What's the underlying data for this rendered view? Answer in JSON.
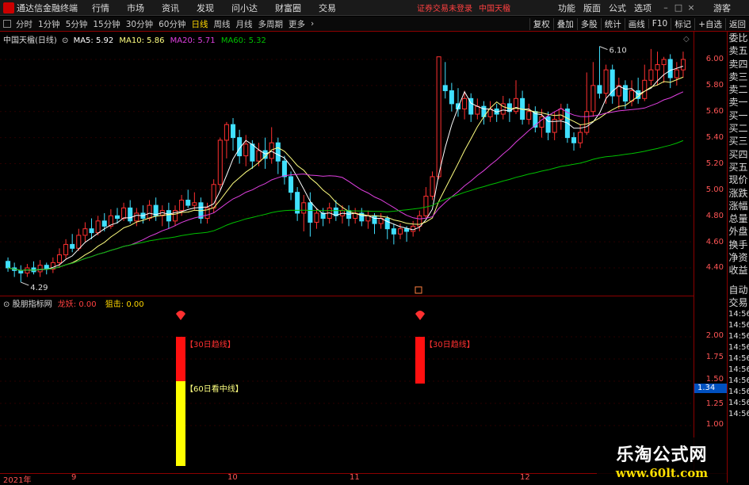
{
  "menubar": {
    "app_title": "通达信金融终端",
    "items": [
      "行情",
      "市场",
      "资讯",
      "发现",
      "问小达",
      "财富圈",
      "交易"
    ],
    "status": "证券交易未登录",
    "stock_name": "中国天楹",
    "right_items": [
      "功能",
      "版面",
      "公式",
      "选项"
    ],
    "guest": "游客"
  },
  "toolbar": {
    "periods": [
      "分时",
      "1分钟",
      "5分钟",
      "15分钟",
      "30分钟",
      "60分钟",
      "日线",
      "周线",
      "月线",
      "多周期",
      "更多"
    ],
    "active_period": "日线",
    "right_buttons": [
      "复权",
      "叠加",
      "多股",
      "统计",
      "画线",
      "F10",
      "标记",
      "+自选",
      "返回"
    ]
  },
  "chart_legend": {
    "title": "中国天楹(日线)",
    "ma5": "MA5: 5.92",
    "ma10": "MA10: 5.86",
    "ma20": "MA20: 5.71",
    "ma60": "MA60: 5.32"
  },
  "indicator_legend": {
    "name": "股朋指标网",
    "item1": "龙妖: 0.00",
    "item2": "狙击: 0.00"
  },
  "colors": {
    "up": "#ff3030",
    "down": "#40e0ff",
    "ma5": "#ffffff",
    "ma10": "#ffff80",
    "ma20": "#e040e0",
    "ma60": "#00c000"
  },
  "price_axis": [
    "6.00",
    "5.80",
    "5.60",
    "5.40",
    "5.20",
    "5.00",
    "4.80",
    "4.60",
    "4.40"
  ],
  "indicator_axis": [
    "2.00",
    "1.75",
    "1.50",
    "1.25",
    "1.00"
  ],
  "indicator_value_badge": "1.34",
  "chart_labels": {
    "high": "6.10",
    "low": "4.29"
  },
  "signals": [
    {
      "label": "【30日趋线】",
      "top": 2.0,
      "bottom": 1.5,
      "color": "red"
    },
    {
      "label": "【60日看中线】",
      "top": 1.5,
      "bottom": 1.0,
      "color": "yellow"
    },
    {
      "label": "【30日趋线】",
      "top": 2.0,
      "bottom": 1.5,
      "color": "red"
    }
  ],
  "date_axis": [
    "2021年",
    "9",
    "10",
    "11",
    "12"
  ],
  "sidebar": {
    "quote_items": [
      "委比",
      "卖五",
      "卖四",
      "卖三",
      "卖二",
      "卖一",
      "买一",
      "买二",
      "买三",
      "买四",
      "买五",
      "现价",
      "涨跌",
      "涨幅",
      "总量",
      "外盘",
      "换手",
      "净资",
      "收益"
    ],
    "trade_items": [
      "自动",
      "交易"
    ],
    "times": [
      "14:56",
      "14:56",
      "14:56",
      "14:56",
      "14:56",
      "14:56",
      "14:56",
      "14:56",
      "14:56",
      "14:56"
    ]
  },
  "watermark": {
    "line1": "乐淘公式网",
    "line2": "www.60lt.com"
  },
  "chart_data": {
    "type": "candlestick",
    "title": "中国天楹(日线)",
    "ylim": [
      4.2,
      6.2
    ],
    "candles": [
      [
        4.45,
        4.4,
        4.48,
        4.37
      ],
      [
        4.4,
        4.38,
        4.44,
        4.33
      ],
      [
        4.38,
        4.36,
        4.42,
        4.29
      ],
      [
        4.36,
        4.4,
        4.43,
        4.33
      ],
      [
        4.4,
        4.37,
        4.45,
        4.35
      ],
      [
        4.37,
        4.42,
        4.46,
        4.33
      ],
      [
        4.42,
        4.39,
        4.44,
        4.35
      ],
      [
        4.39,
        4.44,
        4.48,
        4.36
      ],
      [
        4.44,
        4.5,
        4.55,
        4.4
      ],
      [
        4.5,
        4.58,
        4.62,
        4.47
      ],
      [
        4.58,
        4.55,
        4.66,
        4.52
      ],
      [
        4.55,
        4.65,
        4.7,
        4.53
      ],
      [
        4.65,
        4.7,
        4.75,
        4.6
      ],
      [
        4.7,
        4.67,
        4.78,
        4.62
      ],
      [
        4.67,
        4.76,
        4.8,
        4.65
      ],
      [
        4.76,
        4.72,
        4.82,
        4.68
      ],
      [
        4.72,
        4.8,
        4.85,
        4.7
      ],
      [
        4.8,
        4.78,
        4.86,
        4.74
      ],
      [
        4.78,
        4.86,
        4.9,
        4.76
      ],
      [
        4.86,
        4.76,
        4.92,
        4.74
      ],
      [
        4.76,
        4.82,
        4.86,
        4.72
      ],
      [
        4.82,
        4.78,
        4.88,
        4.74
      ],
      [
        4.78,
        4.88,
        4.92,
        4.76
      ],
      [
        4.88,
        4.8,
        4.94,
        4.76
      ],
      [
        4.8,
        4.84,
        4.88,
        4.72
      ],
      [
        4.84,
        4.76,
        4.9,
        4.7
      ],
      [
        4.76,
        4.84,
        4.88,
        4.72
      ],
      [
        4.84,
        4.92,
        4.96,
        4.8
      ],
      [
        4.92,
        4.88,
        5.0,
        4.86
      ],
      [
        4.88,
        4.9,
        4.98,
        4.84
      ],
      [
        4.9,
        4.78,
        4.94,
        4.74
      ],
      [
        4.78,
        4.86,
        4.9,
        4.74
      ],
      [
        4.86,
        5.04,
        5.08,
        4.82
      ],
      [
        5.04,
        5.38,
        5.4,
        5.0
      ],
      [
        5.38,
        5.5,
        5.52,
        5.24
      ],
      [
        5.5,
        5.4,
        5.55,
        5.3
      ],
      [
        5.4,
        5.26,
        5.46,
        5.2
      ],
      [
        5.26,
        5.35,
        5.42,
        5.18
      ],
      [
        5.35,
        5.22,
        5.38,
        5.16
      ],
      [
        5.22,
        5.3,
        5.36,
        5.18
      ],
      [
        5.3,
        5.24,
        5.4,
        5.16
      ],
      [
        5.24,
        5.36,
        5.48,
        5.2
      ],
      [
        5.36,
        5.22,
        5.4,
        5.12
      ],
      [
        5.22,
        5.1,
        5.26,
        5.04
      ],
      [
        5.1,
        4.98,
        5.14,
        4.92
      ],
      [
        4.98,
        4.82,
        5.02,
        4.76
      ],
      [
        4.82,
        4.9,
        4.96,
        4.68
      ],
      [
        4.9,
        4.75,
        4.98,
        4.64
      ],
      [
        4.75,
        4.82,
        4.86,
        4.7
      ],
      [
        4.82,
        4.78,
        4.86,
        4.72
      ],
      [
        4.78,
        4.86,
        4.9,
        4.74
      ],
      [
        4.86,
        4.8,
        4.92,
        4.76
      ],
      [
        4.8,
        4.84,
        4.88,
        4.74
      ],
      [
        4.84,
        4.78,
        4.88,
        4.72
      ],
      [
        4.78,
        4.82,
        4.86,
        4.74
      ],
      [
        4.82,
        4.76,
        4.86,
        4.72
      ],
      [
        4.76,
        4.8,
        4.84,
        4.7
      ],
      [
        4.8,
        4.74,
        4.82,
        4.66
      ],
      [
        4.74,
        4.78,
        4.82,
        4.7
      ],
      [
        4.78,
        4.7,
        4.8,
        4.62
      ],
      [
        4.7,
        4.66,
        4.74,
        4.58
      ],
      [
        4.66,
        4.7,
        4.74,
        4.62
      ],
      [
        4.7,
        4.68,
        4.72,
        4.6
      ],
      [
        4.68,
        4.72,
        4.76,
        4.64
      ],
      [
        4.72,
        4.8,
        4.84,
        4.68
      ],
      [
        4.8,
        4.95,
        5.02,
        4.78
      ],
      [
        4.95,
        5.1,
        5.14,
        4.92
      ],
      [
        5.1,
        6.02,
        6.02,
        5.08
      ],
      [
        5.8,
        5.76,
        5.98,
        5.7
      ],
      [
        5.76,
        5.66,
        5.82,
        5.6
      ],
      [
        5.66,
        5.62,
        5.78,
        5.56
      ],
      [
        5.62,
        5.7,
        5.76,
        5.54
      ],
      [
        5.7,
        5.58,
        5.74,
        5.52
      ],
      [
        5.58,
        5.64,
        5.7,
        5.54
      ],
      [
        5.64,
        5.56,
        5.68,
        5.5
      ],
      [
        5.56,
        5.62,
        5.68,
        5.52
      ],
      [
        5.62,
        5.58,
        5.66,
        5.52
      ],
      [
        5.58,
        5.66,
        5.72,
        5.54
      ],
      [
        5.66,
        5.6,
        5.7,
        5.52
      ],
      [
        5.6,
        5.7,
        5.84,
        5.58
      ],
      [
        5.7,
        5.54,
        5.76,
        5.5
      ],
      [
        5.54,
        5.6,
        5.66,
        5.5
      ],
      [
        5.6,
        5.48,
        5.64,
        5.44
      ],
      [
        5.48,
        5.56,
        5.62,
        5.4
      ],
      [
        5.56,
        5.44,
        5.6,
        5.38
      ],
      [
        5.44,
        5.54,
        5.6,
        5.38
      ],
      [
        5.54,
        5.62,
        5.66,
        5.46
      ],
      [
        5.62,
        5.4,
        5.66,
        5.36
      ],
      [
        5.4,
        5.36,
        5.44,
        5.3
      ],
      [
        5.36,
        5.44,
        5.5,
        5.32
      ],
      [
        5.44,
        5.6,
        5.9,
        5.42
      ],
      [
        5.6,
        5.8,
        5.98,
        5.56
      ],
      [
        5.8,
        5.74,
        6.1,
        5.7
      ],
      [
        5.74,
        5.92,
        5.96,
        5.66
      ],
      [
        5.92,
        5.72,
        5.96,
        5.66
      ],
      [
        5.72,
        5.8,
        5.86,
        5.62
      ],
      [
        5.8,
        5.68,
        5.84,
        5.62
      ],
      [
        5.68,
        5.76,
        5.84,
        5.64
      ],
      [
        5.76,
        5.7,
        5.86,
        5.66
      ],
      [
        5.7,
        5.84,
        5.96,
        5.68
      ],
      [
        5.84,
        5.92,
        6.08,
        5.8
      ],
      [
        5.92,
        5.96,
        6.06,
        5.8
      ],
      [
        5.96,
        6.0,
        6.02,
        5.82
      ],
      [
        6.0,
        5.86,
        6.04,
        5.78
      ],
      [
        5.86,
        5.92,
        5.98,
        5.8
      ],
      [
        5.92,
        6.0,
        6.06,
        5.86
      ]
    ]
  }
}
